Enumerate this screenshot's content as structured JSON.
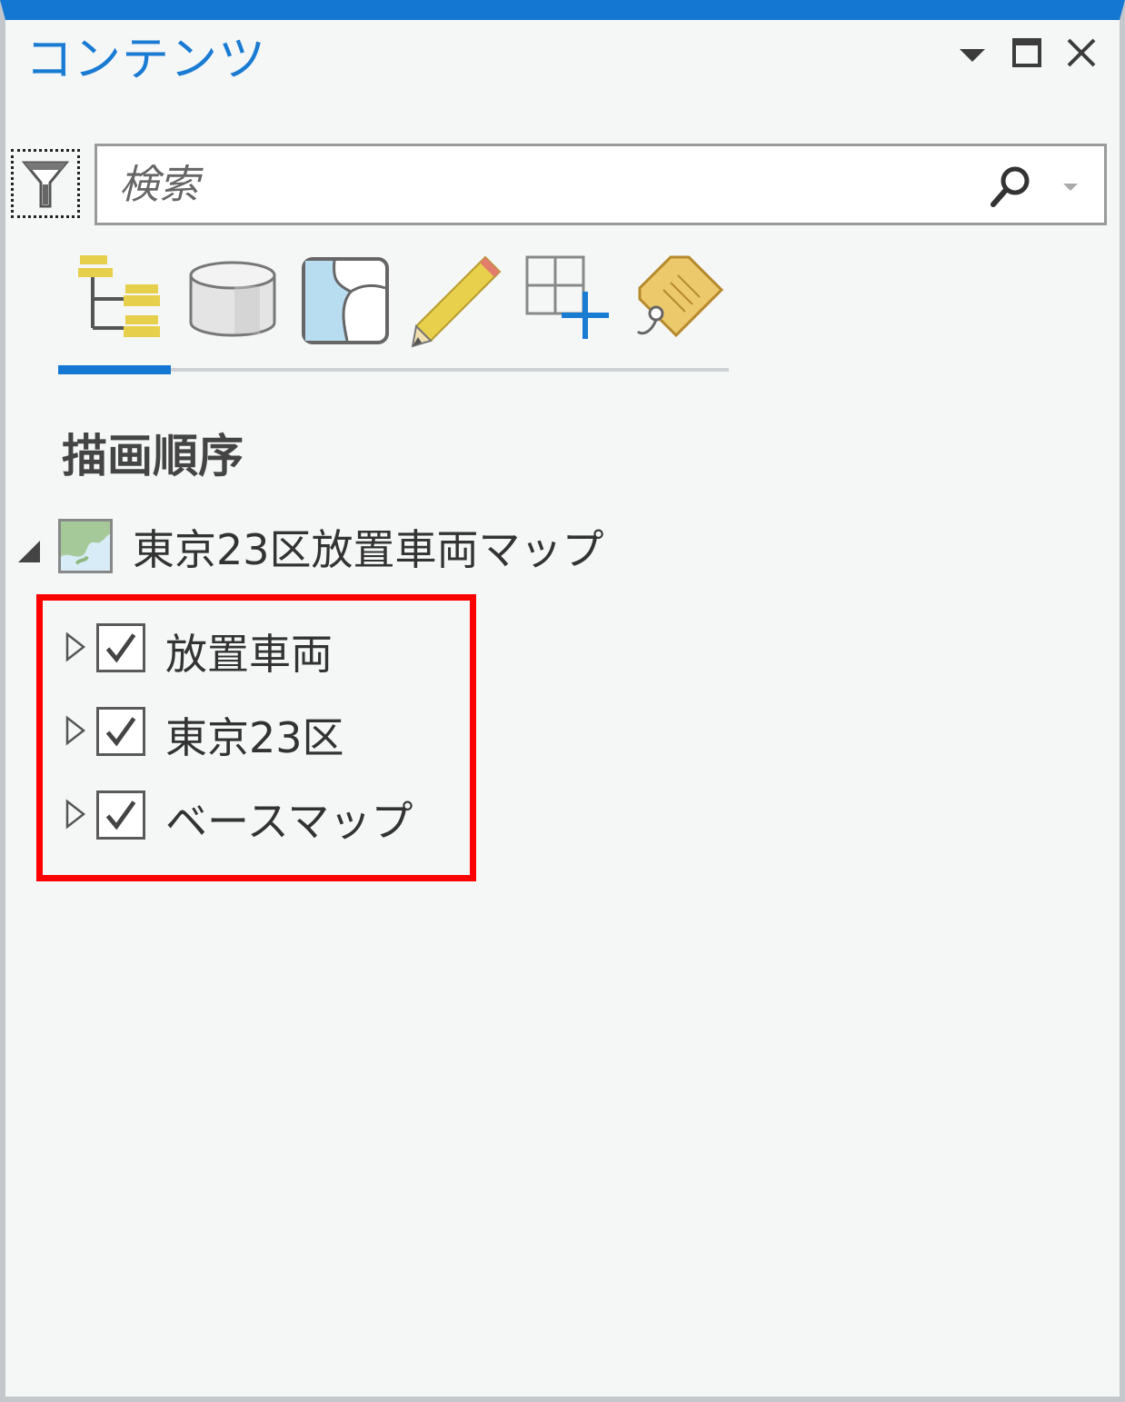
{
  "pane": {
    "title": "コンテンツ",
    "controls": [
      "dropdown-arrow-icon",
      "maximize-icon",
      "close-icon"
    ]
  },
  "search": {
    "placeholder": "検索",
    "value": ""
  },
  "toolbar": {
    "filter_icon": "filter-icon",
    "tabs": [
      {
        "icon": "drawing-order-icon",
        "active": true
      },
      {
        "icon": "data-source-icon",
        "active": false
      },
      {
        "icon": "selection-map-icon",
        "active": false
      },
      {
        "icon": "editing-pencil-icon",
        "active": false
      },
      {
        "icon": "snapping-grid-icon",
        "active": false
      },
      {
        "icon": "labeling-tag-icon",
        "active": false
      }
    ]
  },
  "section": {
    "heading": "描画順序"
  },
  "map": {
    "name": "東京23区放置車両マップ",
    "expanded": true,
    "layers": [
      {
        "name": "放置車両",
        "checked": true
      },
      {
        "name": "東京23区",
        "checked": true
      },
      {
        "name": "ベースマップ",
        "checked": true
      }
    ]
  },
  "colors": {
    "accent": "#1478d2",
    "highlight": "#ff0000",
    "background": "#f5f7f7"
  }
}
